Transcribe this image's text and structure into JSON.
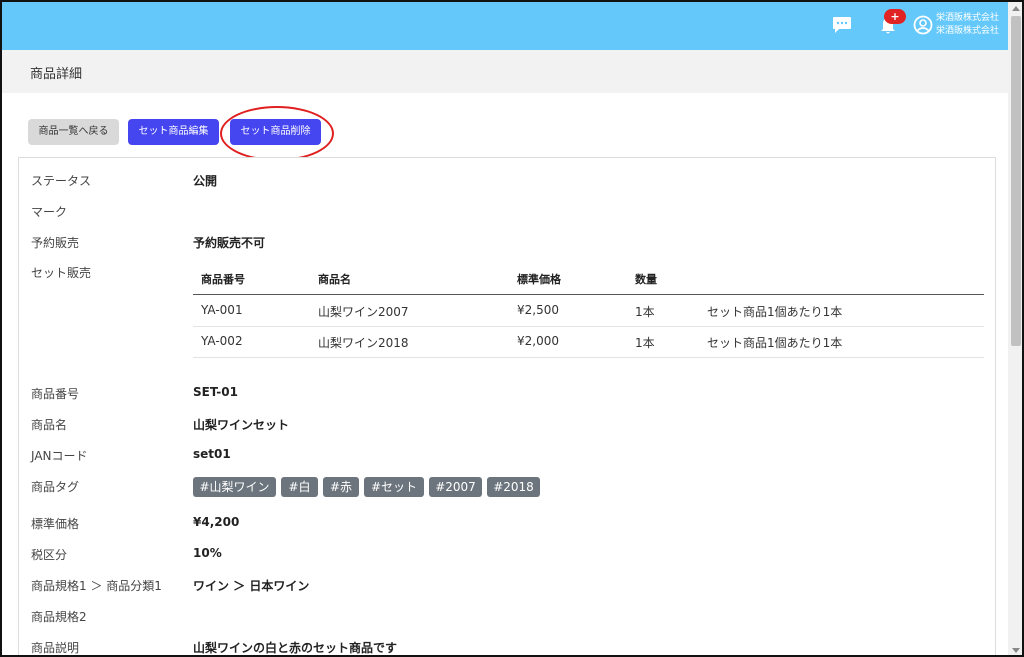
{
  "header": {
    "notification_count": "+",
    "company_line1": "栄酒販株式会社",
    "company_line2": "栄酒販株式会社",
    "icons": [
      "chat-icon",
      "bell-icon",
      "user-circle-icon"
    ],
    "bg_color": "#64c8fa"
  },
  "page": {
    "title": "商品詳細"
  },
  "buttons": {
    "back": "商品一覧へ戻る",
    "edit": "セット商品編集",
    "delete": "セット商品削除"
  },
  "details": {
    "status_label": "ステータス",
    "status_value": "公開",
    "mark_label": "マーク",
    "preorder_label": "予約販売",
    "preorder_value": "予約販売不可",
    "set_label": "セット販売",
    "set_table": {
      "headers": [
        "商品番号",
        "商品名",
        "標準価格",
        "数量"
      ],
      "rows": [
        {
          "code": "YA-001",
          "name": "山梨ワイン2007",
          "price": "¥2,500",
          "qty": "1本",
          "note": "セット商品1個あたり1本"
        },
        {
          "code": "YA-002",
          "name": "山梨ワイン2018",
          "price": "¥2,000",
          "qty": "1本",
          "note": "セット商品1個あたり1本"
        }
      ]
    },
    "code_label": "商品番号",
    "code_value": "SET-01",
    "name_label": "商品名",
    "name_value": "山梨ワインセット",
    "jan_label": "JANコード",
    "jan_value": "set01",
    "tags_label": "商品タグ",
    "tags": [
      "#山梨ワイン",
      "#白",
      "#赤",
      "#セット",
      "#2007",
      "#2018"
    ],
    "price_label": "標準価格",
    "price_value": "¥4,200",
    "tax_label": "税区分",
    "tax_value": "10%",
    "spec1_label": "商品規格1 ＞ 商品分類1",
    "spec1_value": "ワイン ＞ 日本ワイン",
    "spec2_label": "商品規格2",
    "desc_label": "商品説明",
    "desc_value": "山梨ワインの白と赤のセット商品です"
  }
}
